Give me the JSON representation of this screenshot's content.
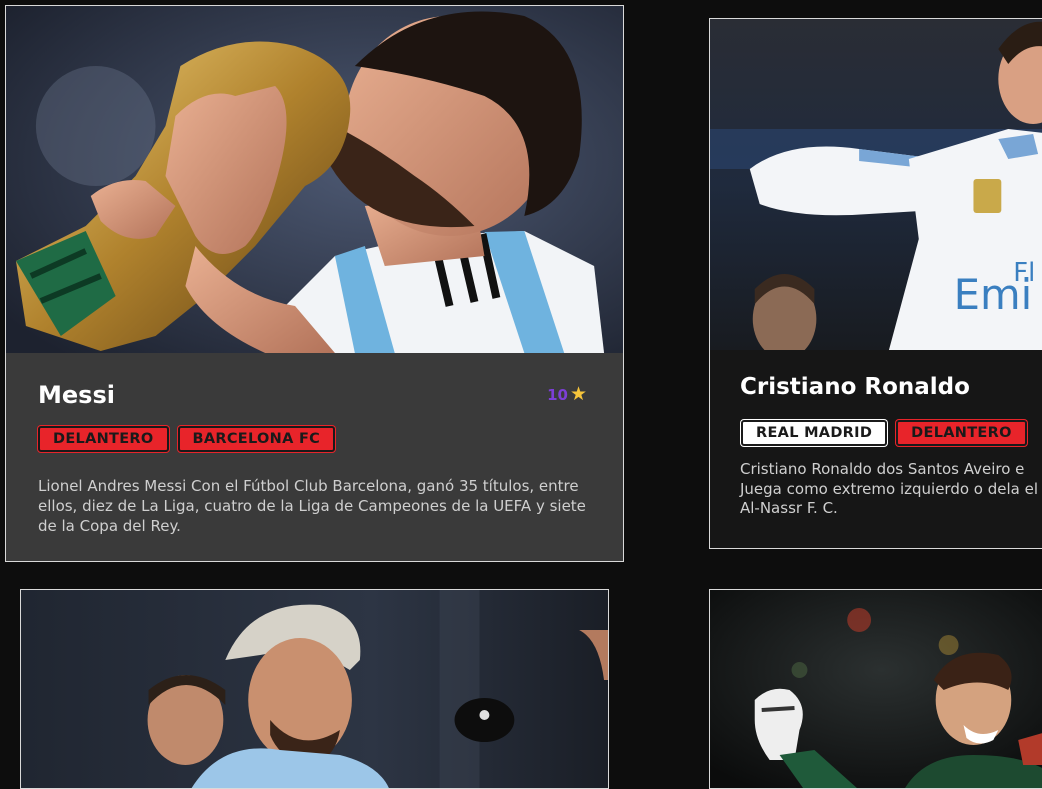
{
  "cards": [
    {
      "name": "Messi",
      "rating": "10",
      "rating_icon": "star-icon",
      "tags": [
        {
          "label": "DELANTERO",
          "style": "red"
        },
        {
          "label": "BARCELONA FC",
          "style": "red"
        }
      ],
      "description": "Lionel Andres Messi Con el Fútbol Club Barcelona, ganó 35 títulos, entre ellos, diez de La Liga, cuatro de la Liga de Campeones de la UEFA y siete de la Copa del Rey."
    },
    {
      "name": "Cristiano Ronaldo",
      "tags": [
        {
          "label": "REAL MADRID",
          "style": "white"
        },
        {
          "label": "DELANTERO",
          "style": "red"
        }
      ],
      "description": "Cristiano Ronaldo dos Santos Aveiro e Juega como extremo izquierdo o dela el Al-Nassr F. C."
    },
    {
      "name": "",
      "tags": [],
      "description": ""
    },
    {
      "name": "",
      "tags": [],
      "description": ""
    }
  ],
  "colors": {
    "page_background": "#0d0d0d",
    "card_body": "#3a3a3a",
    "card_body_alt": "#161616",
    "tag_red": "#e8242a",
    "tag_white": "#ffffff",
    "rating_number": "#7c3fd6",
    "rating_star": "#f6c53b"
  }
}
